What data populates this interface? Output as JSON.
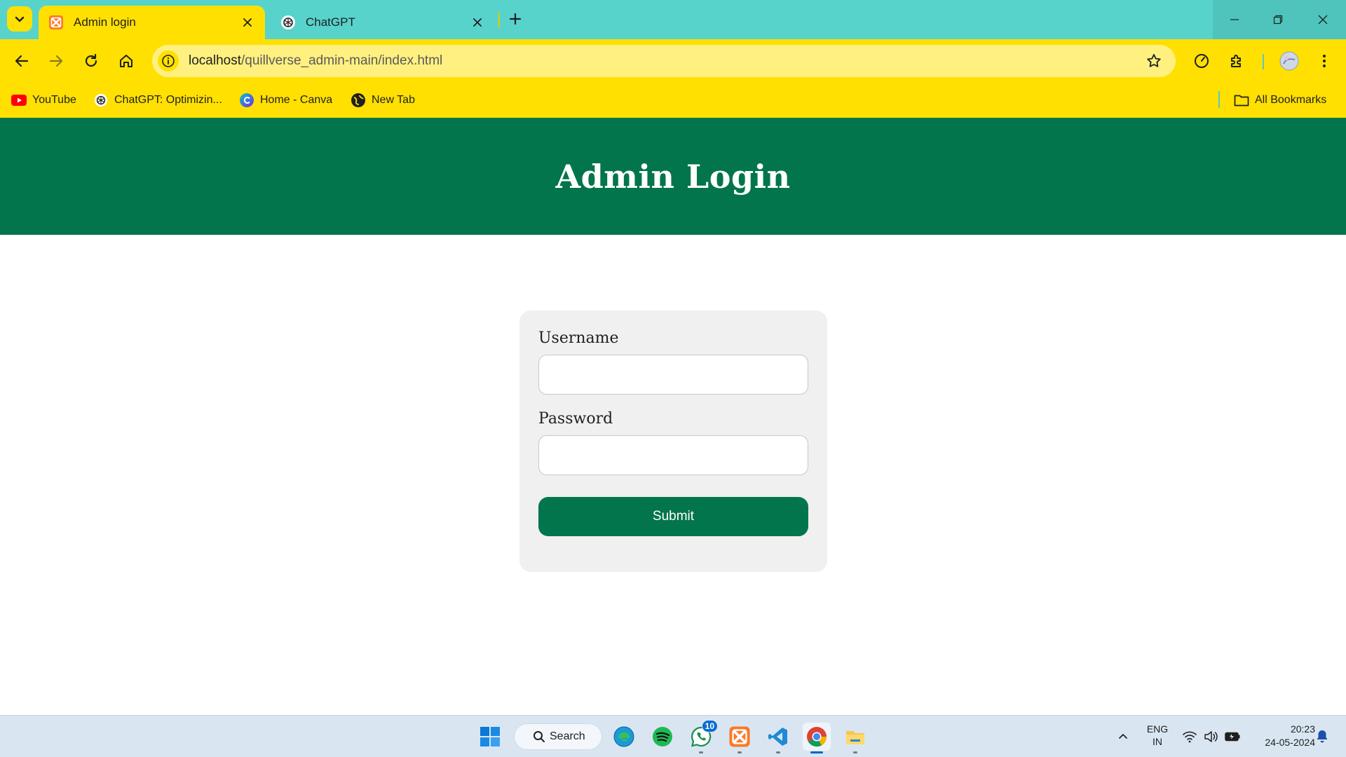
{
  "browser": {
    "tabs": [
      {
        "title": "Admin login",
        "icon": "xampp-icon",
        "active": true
      },
      {
        "title": "ChatGPT",
        "icon": "chatgpt-icon",
        "active": false
      }
    ],
    "address_bar": {
      "host": "localhost",
      "path": "/quillverse_admin-main/index.html"
    },
    "bookmarks": [
      {
        "label": "YouTube",
        "icon": "youtube-icon"
      },
      {
        "label": "ChatGPT: Optimizin...",
        "icon": "chatgpt-icon"
      },
      {
        "label": "Home - Canva",
        "icon": "canva-icon"
      },
      {
        "label": "New Tab",
        "icon": "globe-icon"
      }
    ],
    "all_bookmarks_label": "All Bookmarks",
    "colors": {
      "frame": "#57d3cc",
      "toolbar": "#ffe000"
    }
  },
  "page": {
    "title": "Admin Login",
    "form": {
      "username_label": "Username",
      "username_value": "",
      "password_label": "Password",
      "password_value": "",
      "submit_label": "Submit"
    },
    "colors": {
      "primary": "#03754c",
      "card": "#f0f0f0"
    }
  },
  "taskbar": {
    "search_label": "Search",
    "apps": [
      "windows-start-icon",
      "edge-icon",
      "spotify-icon",
      "whatsapp-icon",
      "xampp-icon",
      "vscode-icon",
      "chrome-icon",
      "file-explorer-icon"
    ],
    "whatsapp_badge": "10",
    "language_line1": "ENG",
    "language_line2": "IN",
    "time": "20:23",
    "date": "24-05-2024"
  }
}
